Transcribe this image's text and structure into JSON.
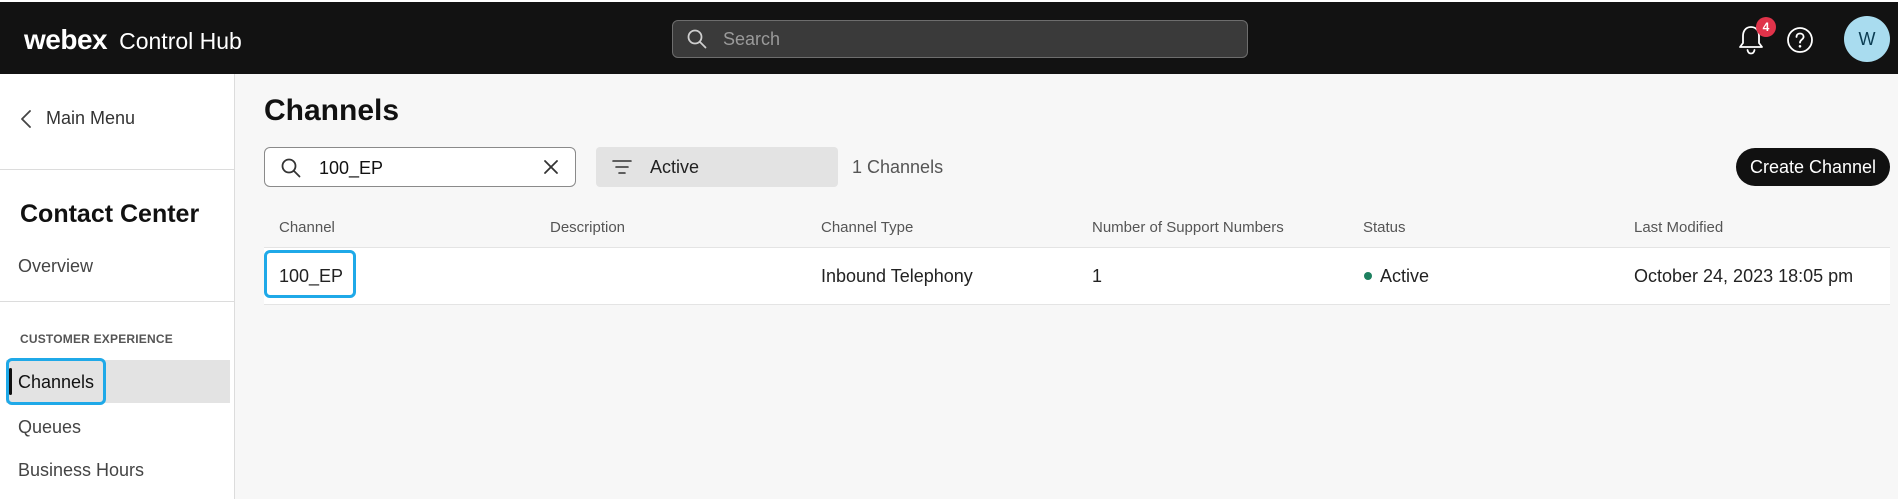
{
  "header": {
    "logo": "webex",
    "product": "Control Hub",
    "search_placeholder": "Search",
    "notification_count": "4",
    "avatar_initial": "W"
  },
  "sidebar": {
    "main_menu": "Main Menu",
    "title": "Contact Center",
    "overview": "Overview",
    "section_label": "CUSTOMER EXPERIENCE",
    "items": [
      {
        "label": "Channels",
        "selected": true
      },
      {
        "label": "Queues"
      },
      {
        "label": "Business Hours"
      }
    ]
  },
  "main": {
    "title": "Channels",
    "search_value": "100_EP",
    "status_filter": "Active",
    "count_text": "1 Channels",
    "create_button": "Create Channel",
    "columns": [
      "Channel",
      "Description",
      "Channel Type",
      "Number of Support Numbers",
      "Status",
      "Last Modified"
    ],
    "rows": [
      {
        "channel": "100_EP",
        "description": "",
        "channel_type": "Inbound Telephony",
        "support_numbers": "1",
        "status": "Active",
        "last_modified": "October 24, 2023 18:05 pm"
      }
    ]
  },
  "colors": {
    "topbar": "#121212",
    "focus_ring": "#1fa9e8",
    "status_active": "#1d805f",
    "badge": "#e0334a",
    "avatar": "#a9dcef"
  }
}
